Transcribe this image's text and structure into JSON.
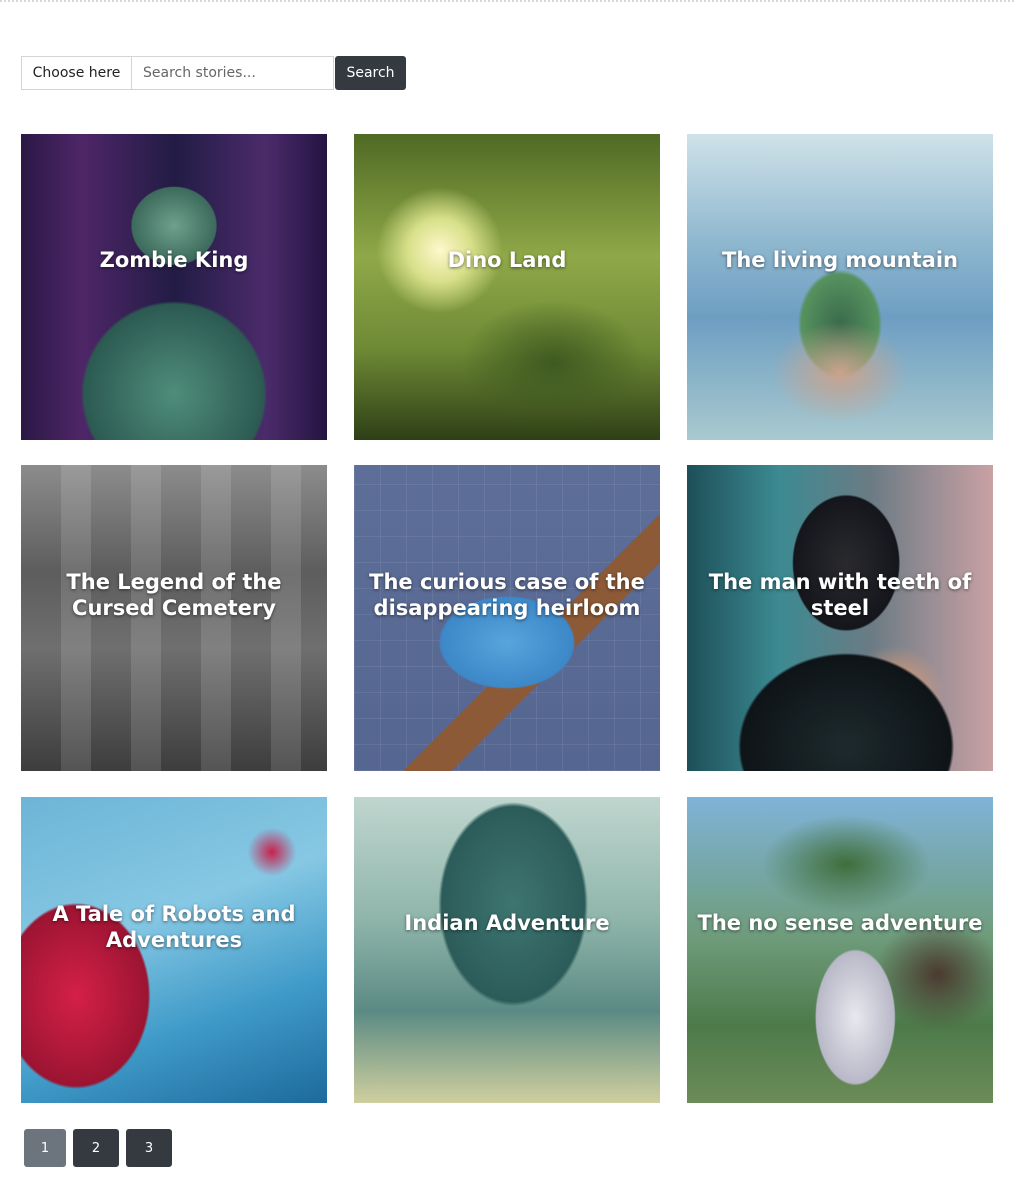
{
  "search": {
    "dropdown_label": "Choose here",
    "input_placeholder": "Search stories...",
    "input_value": "",
    "button_label": "Search"
  },
  "stories": [
    {
      "title": "Zombie King",
      "art": "art-zombie"
    },
    {
      "title": "Dino Land",
      "art": "art-dino"
    },
    {
      "title": "The living mountain",
      "art": "art-mountain"
    },
    {
      "title": "The Legend of the Cursed Cemetery",
      "art": "art-cemetery"
    },
    {
      "title": "The curious case of the disappearing heirloom",
      "art": "art-heirloom"
    },
    {
      "title": "The man with teeth of steel",
      "art": "art-steel"
    },
    {
      "title": "A Tale of Robots and Adventures",
      "art": "art-robots"
    },
    {
      "title": "Indian Adventure",
      "art": "art-indian"
    },
    {
      "title": "The no sense adventure",
      "art": "art-nosense"
    }
  ],
  "pagination": {
    "pages": [
      "1",
      "2",
      "3"
    ],
    "active": "1"
  },
  "colors": {
    "button_dark": "#343a40",
    "page_active": "#6c757d",
    "title_text": "#ffffff"
  }
}
